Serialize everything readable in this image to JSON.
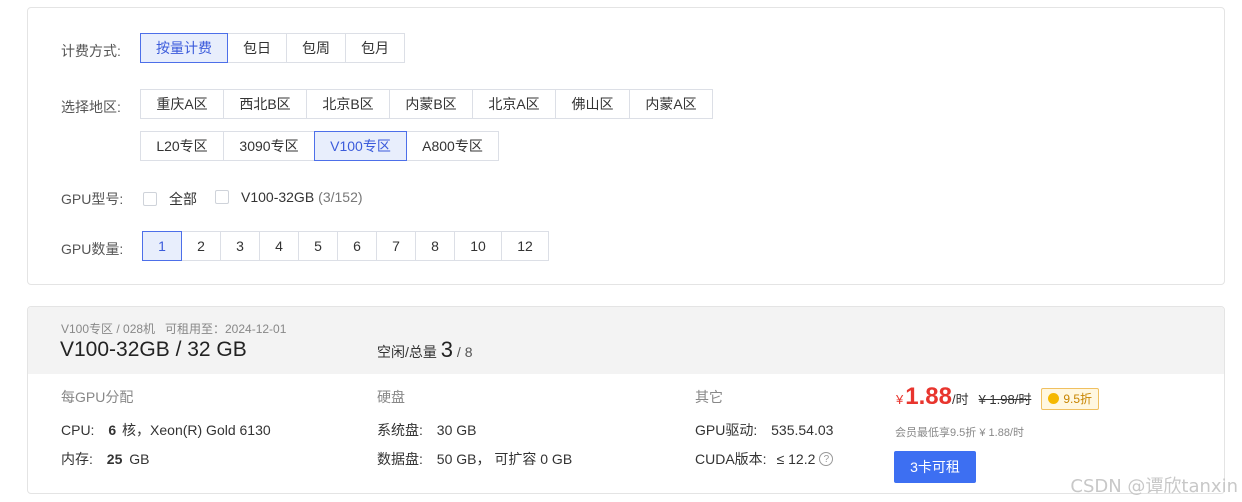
{
  "filters": {
    "billing_label": "计费方式:",
    "billing": [
      "按量计费",
      "包日",
      "包周",
      "包月"
    ],
    "region_label": "选择地区:",
    "regions_row1": [
      "重庆A区",
      "西北B区",
      "北京B区",
      "内蒙B区",
      "北京A区",
      "佛山区",
      "内蒙A区"
    ],
    "regions_row2": [
      "L20专区",
      "3090专区",
      "V100专区",
      "A800专区"
    ],
    "gpu_model_label": "GPU型号:",
    "gpu_model_all": "全部",
    "gpu_model_option": "V100-32GB",
    "gpu_model_count": "(3/152)",
    "gpu_count_label": "GPU数量:",
    "gpu_counts": [
      "1",
      "2",
      "3",
      "4",
      "5",
      "6",
      "7",
      "8",
      "10",
      "12"
    ]
  },
  "machine": {
    "meta": "V100专区 / 028机",
    "rent_until": "可租用至：2024-12-01",
    "title": "V100-32GB / 32 GB",
    "idle_label": "空闲/总量",
    "idle": "3",
    "total": "/ 8",
    "per_gpu_label": "每GPU分配",
    "cpu_label": "CPU:",
    "cpu_count": "6",
    "cpu_desc": "核，Xeon(R) Gold 6130",
    "mem_label": "内存:",
    "mem_value": "25",
    "mem_unit": "GB",
    "disk_label": "硬盘",
    "sys_disk_label": "系统盘:",
    "sys_disk_value": "30 GB",
    "data_disk_label": "数据盘:",
    "data_disk_value": "50 GB，  可扩容 0 GB",
    "other_label": "其它",
    "gpu_driver_label": "GPU驱动:",
    "gpu_driver_value": "535.54.03",
    "cuda_label": "CUDA版本:",
    "cuda_value": "≤ 12.2",
    "currency": "¥",
    "price": "1.88",
    "price_unit": "/时",
    "original_price": "¥ 1.98/时",
    "discount": "9.5折",
    "member_note": "会员最低享9.5折 ¥ 1.88/时",
    "rent_button": "3卡可租"
  },
  "watermark": "CSDN @谭欣tanxin",
  "colors": {
    "accent": "#3d6ff2",
    "price": "#e8352e",
    "active_bg": "#e8eefc"
  }
}
